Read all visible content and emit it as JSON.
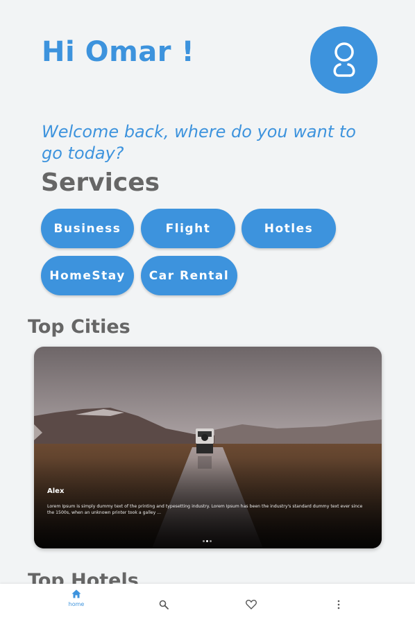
{
  "header": {
    "greeting": "Hi Omar !",
    "avatar_icon": "user-icon"
  },
  "welcome_text": "Welcome back, where do you want to go today?",
  "services": {
    "title": "Services",
    "items": [
      "Business",
      "Flight",
      "Hotles",
      "HomeStay",
      "Car Rental"
    ]
  },
  "top_cities": {
    "title": "Top Cities",
    "card": {
      "title": "Alex",
      "description": "Lorem Ipsum is simply dummy text of the printing and typesetting industry. Lorem Ipsum has been the industry's standard dummy text ever since the 1500s, when an unknown printer took a galley ...",
      "slides_count": 3,
      "active_slide": 1
    }
  },
  "top_hotels": {
    "title": "Top Hotels"
  },
  "bottom_nav": {
    "items": [
      {
        "icon": "home-icon",
        "label": "home",
        "active": true
      },
      {
        "icon": "search-icon",
        "label": "",
        "active": false
      },
      {
        "icon": "heart-icon",
        "label": "",
        "active": false
      },
      {
        "icon": "more-vertical-icon",
        "label": "",
        "active": false
      }
    ]
  },
  "colors": {
    "accent": "#3d93dd",
    "background": "#f2f4f5",
    "heading": "#666666"
  }
}
